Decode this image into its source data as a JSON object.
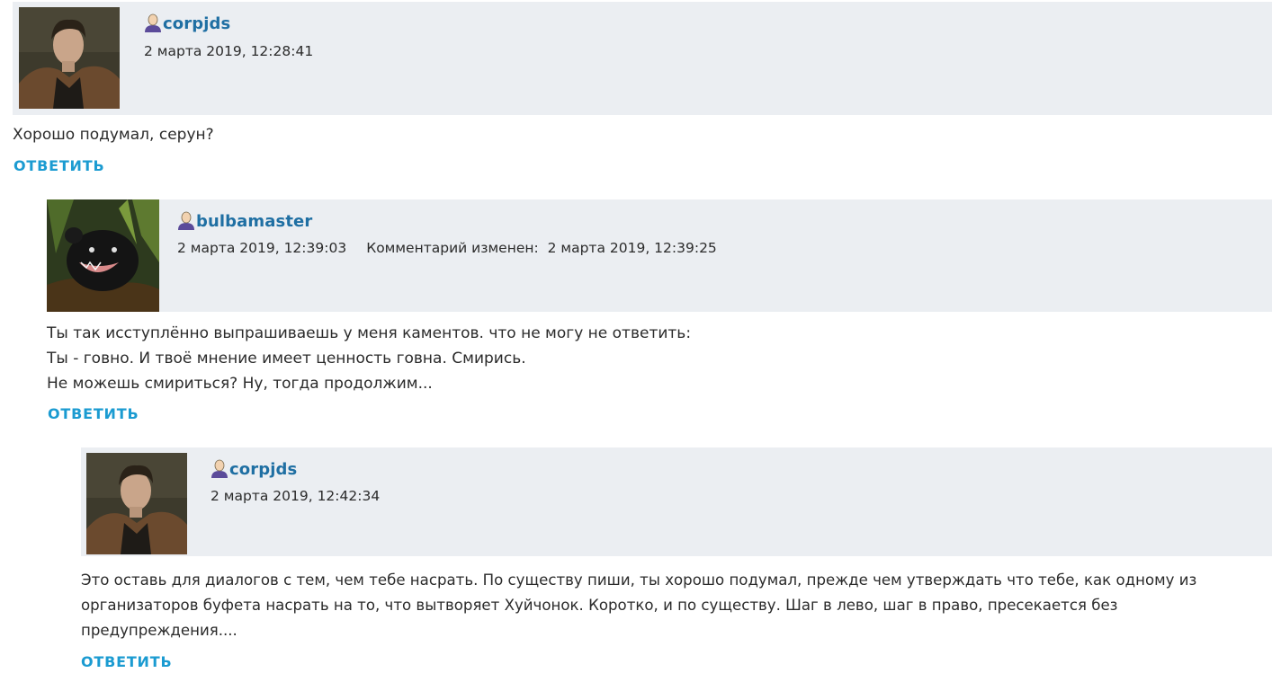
{
  "comments": [
    {
      "username": "corpjds",
      "date": "2 марта 2019, 12:28:41",
      "edited_label": "",
      "edited_date": "",
      "avatar": "man-portrait-avatar",
      "body_lines": [
        "Хорошо подумал, серун?"
      ],
      "reply_label": "ОТВЕТИТЬ"
    },
    {
      "username": "bulbamaster",
      "date": "2 марта 2019, 12:39:03",
      "edited_label": "Комментарий изменен:",
      "edited_date": "2 марта 2019, 12:39:25",
      "avatar": "binturong-animal-avatar",
      "body_lines": [
        "Ты так исступлённо выпрашиваешь у меня каментов. что не могу не ответить:",
        "Ты - говно. И твоё мнение имеет ценность говна. Смирись.",
        "Не можешь смириться? Ну, тогда продолжим..."
      ],
      "reply_label": "ОТВЕТИТЬ"
    },
    {
      "username": "corpjds",
      "date": "2 марта 2019, 12:42:34",
      "edited_label": "",
      "edited_date": "",
      "avatar": "man-portrait-avatar",
      "body_lines": [
        "Это оставь для диалогов с тем, чем тебе насрать. По существу пиши, ты хорошо подумал, прежде чем утверждать что тебе, как одному из",
        "организаторов буфета насрать на то, что вытворяет Хуйчонок. Коротко, и по существу. Шаг в лево, шаг в право, пресекается без",
        "предупреждения...."
      ],
      "reply_label": "ОТВЕТИТЬ"
    }
  ],
  "colors": {
    "header_bg": "#ebeef2",
    "username": "#1f6fa3",
    "reply": "#1b9bd1",
    "text": "#2b2b2b"
  }
}
